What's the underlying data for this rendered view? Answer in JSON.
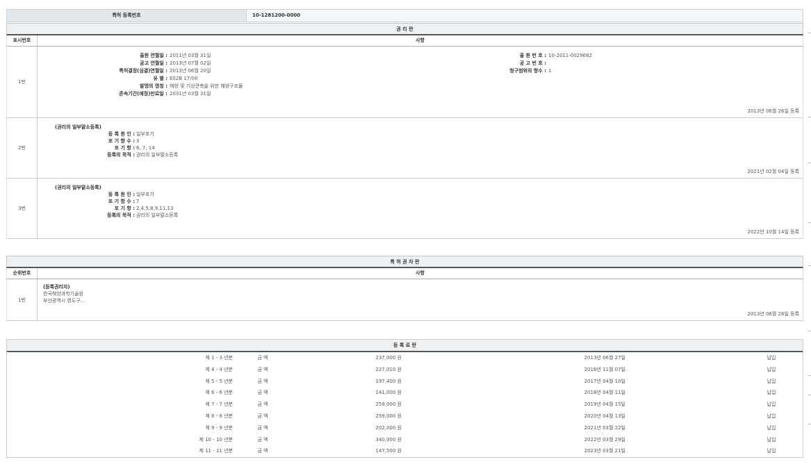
{
  "reg": {
    "label": "특허 등록번호",
    "value": "10-1281200-0000"
  },
  "rights": {
    "title": "권 리 란",
    "col_num": "표시번호",
    "col_content": "사항",
    "row1": {
      "num": "1번",
      "left": [
        {
          "k": "출원 연월일 :",
          "v": "2011년 03월 31일"
        },
        {
          "k": "공고 연월일 :",
          "v": "2013년 07월 02일"
        },
        {
          "k": "특허결정(심결)연월일 :",
          "v": "2013년 06월 20일"
        },
        {
          "k": "유 별 :",
          "v": "E02B 17/00"
        },
        {
          "k": "발명의 명칭 :",
          "v": "해양 및 기상관측을 위한 해양구조물"
        },
        {
          "k": "존속기간(예정)만료일 :",
          "v": "2031년 03월 31일"
        }
      ],
      "right": [
        {
          "k": "출 원 번 호 :",
          "v": "10-2011-0029682"
        },
        {
          "k": "공 고 번 호 :",
          "v": ""
        },
        {
          "k": "청구범위의 항수 :",
          "v": "1"
        }
      ],
      "date": "2013년 06월 26일 등록"
    },
    "row2": {
      "num": "2번",
      "title": "(권리의 일부말소등록)",
      "items": [
        {
          "k": "등 록 원 인 :",
          "v": "일부포기"
        },
        {
          "k": "포 기 항 수 :",
          "v": "3"
        },
        {
          "k": "포 기 항 :",
          "v": "6, 7, 14"
        },
        {
          "k": "등록의 목적 :",
          "v": "권리의 일부말소등록"
        }
      ],
      "date": "2021년 02월 04일 등록"
    },
    "row3": {
      "num": "3번",
      "title": "(권리의 일부말소등록)",
      "items": [
        {
          "k": "등 록 원 인 :",
          "v": "일부포기"
        },
        {
          "k": "포 기 항 수 :",
          "v": "7"
        },
        {
          "k": "포 기 항 :",
          "v": "2,4,5,8,9,11,13"
        },
        {
          "k": "등록의 목적 :",
          "v": "권리의 일부말소등록"
        }
      ],
      "date": "2022년 10월 14일 등록"
    }
  },
  "holders": {
    "title": "특 허 권 자 란",
    "col_num": "순위번호",
    "col_content": "사항",
    "row1": {
      "num": "1번",
      "lines": [
        "(등록권리자)",
        "한국해양과학기술원",
        "부산광역시 영도구..."
      ],
      "date": "2013년 06월 26일 등록"
    }
  },
  "fees": {
    "title": "등 록 료 란",
    "rows": [
      {
        "period": "제 1 - 3 년분",
        "label": "금 액",
        "amount": "237,000 원",
        "date": "2013년 06월 27일",
        "status": "납입"
      },
      {
        "period": "제 4 - 4 년분",
        "label": "금 액",
        "amount": "227,010 원",
        "date": "2016년 11월 07일",
        "status": "납입"
      },
      {
        "period": "제 5 - 5 년분",
        "label": "금 액",
        "amount": "197,400 원",
        "date": "2017년 04월 10일",
        "status": "납입"
      },
      {
        "period": "제 6 - 6 년분",
        "label": "금 액",
        "amount": "141,000 원",
        "date": "2018년 04월 11일",
        "status": "납입"
      },
      {
        "period": "제 7 - 7 년분",
        "label": "금 액",
        "amount": "259,000 원",
        "date": "2019년 04월 15일",
        "status": "납입"
      },
      {
        "period": "제 8 - 8 년분",
        "label": "금 액",
        "amount": "259,000 원",
        "date": "2020년 04월 13일",
        "status": "납입"
      },
      {
        "period": "제 9 - 9 년분",
        "label": "금 액",
        "amount": "202,000 원",
        "date": "2021년 03월 22일",
        "status": "납입"
      },
      {
        "period": "제 10 - 10 년분",
        "label": "금 액",
        "amount": "340,000 원",
        "date": "2022년 03월 29일",
        "status": "납입"
      },
      {
        "period": "제 11 - 11 년분",
        "label": "금 액",
        "amount": "147,500 원",
        "date": "2023년 03월 21일",
        "status": "납입"
      }
    ]
  }
}
